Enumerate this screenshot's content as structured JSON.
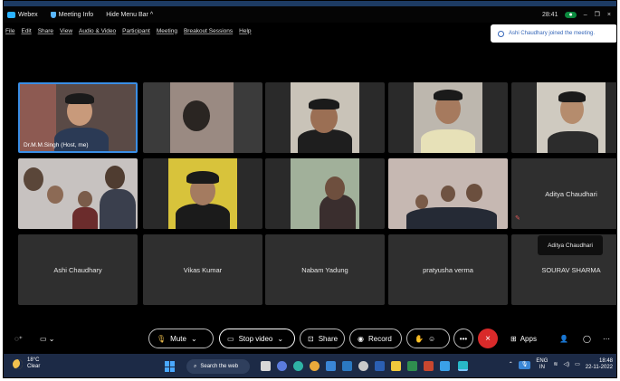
{
  "titlebar": {
    "app_name": "Webex",
    "meeting_info": "Meeting Info",
    "hide_menu": "Hide Menu Bar ^",
    "timer": "28:41",
    "minimize": "–",
    "restore": "❐",
    "close": "×"
  },
  "menu": [
    "File",
    "Edit",
    "Share",
    "View",
    "Audio & Video",
    "Participant",
    "Meeting",
    "Breakout Sessions",
    "Help"
  ],
  "toast": {
    "text": "Ashi Chaudhary joined the meeting."
  },
  "host_label": "Dr.M.M.Singh (Host, me)",
  "name_tiles": {
    "aditya": "Aditya Chaudhari",
    "ashi": "Ashi Chaudhary",
    "vikas": "Vikas Kumar",
    "nabam": "Nabam Yadung",
    "pratyusha": "pratyusha verma",
    "sourav": "SOURAV SHARMA"
  },
  "tooltip": "Aditya Chaudhari",
  "controls": {
    "mute": "Mute",
    "stop_video": "Stop video",
    "share": "Share",
    "record": "Record",
    "apps": "Apps"
  },
  "taskbar": {
    "temp": "18°C",
    "weather": "Clear",
    "search": "Search the web",
    "lang_top": "ENG",
    "lang_bottom": "IN",
    "time": "18:48",
    "date": "22-11-2022"
  },
  "colors": {
    "accent": "#3a8ee6",
    "end_call": "#d92a2a",
    "taskbar": "#1c2a46"
  }
}
